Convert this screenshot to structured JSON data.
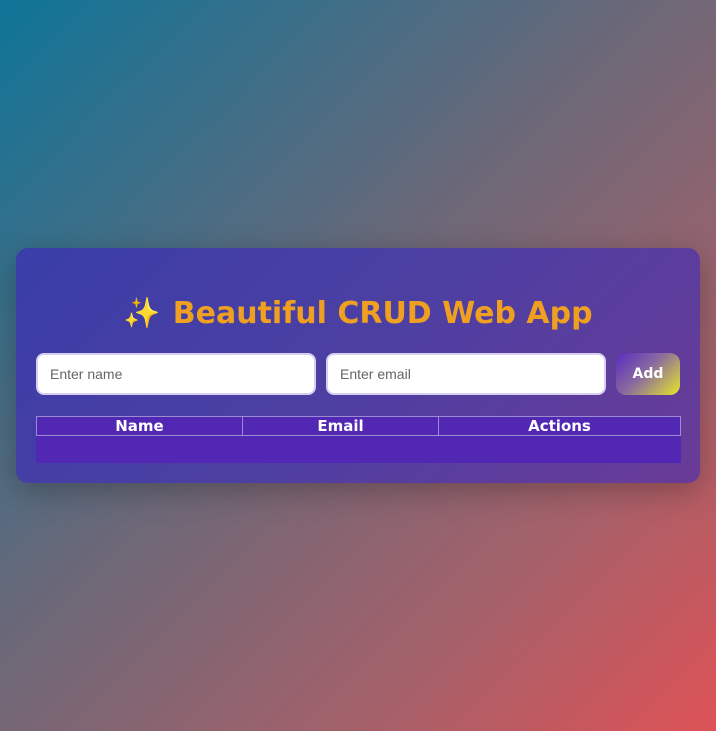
{
  "app": {
    "title_icon": "✨",
    "title": "Beautiful CRUD Web App"
  },
  "form": {
    "name_placeholder": "Enter name",
    "name_value": "",
    "email_placeholder": "Enter email",
    "email_value": "",
    "add_label": "Add"
  },
  "table": {
    "columns": [
      "Name",
      "Email",
      "Actions"
    ],
    "rows": []
  },
  "colors": {
    "title": "#f0a020",
    "card": "#4d3fa2",
    "table_header": "#5227b4"
  }
}
